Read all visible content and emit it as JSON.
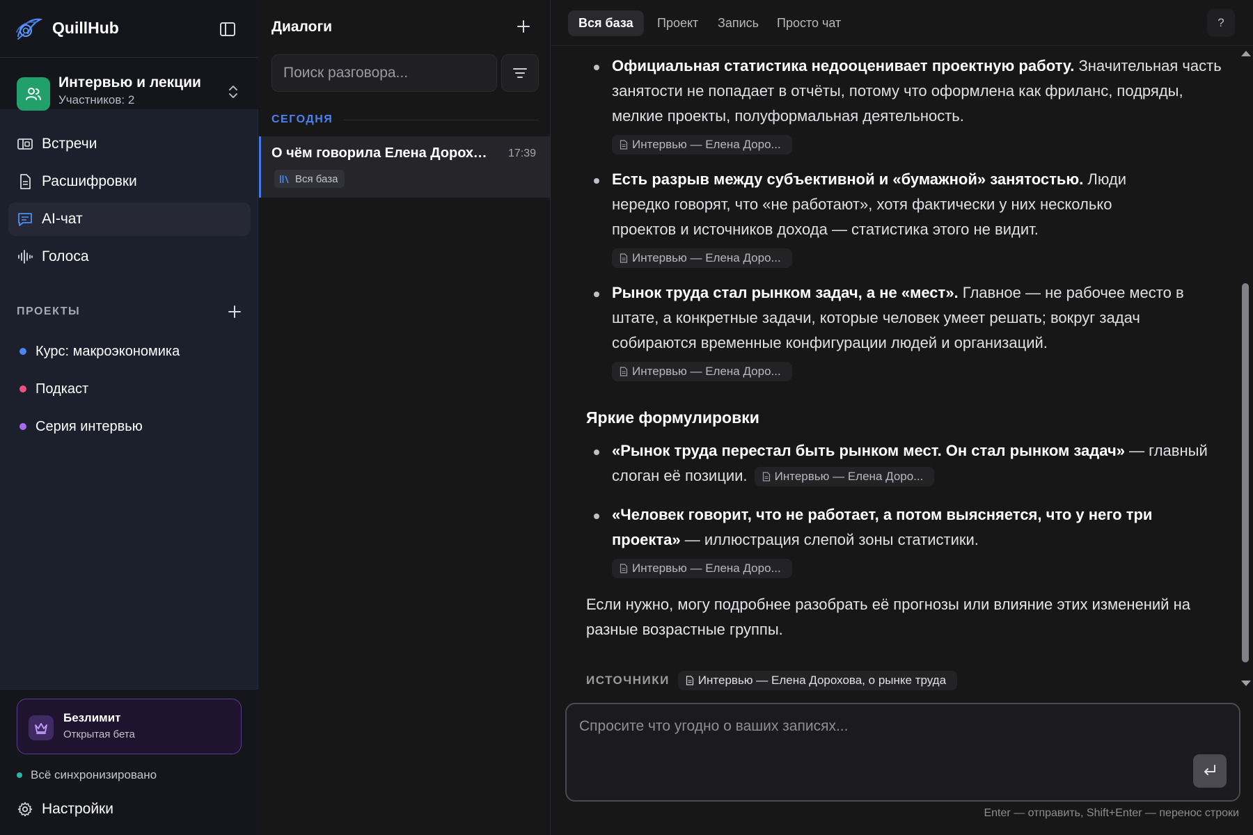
{
  "app": {
    "name": "QuillHub"
  },
  "workspace": {
    "name": "Интервью и лекции",
    "members": "Участников: 2"
  },
  "nav": [
    {
      "label": "Встречи",
      "icon": "meetings-icon"
    },
    {
      "label": "Расшифровки",
      "icon": "document-icon"
    },
    {
      "label": "AI-чат",
      "icon": "chat-icon",
      "active": true
    },
    {
      "label": "Голоса",
      "icon": "waveform-icon"
    }
  ],
  "projects": {
    "heading": "ПРОЕКТЫ",
    "items": [
      {
        "label": "Курс: макроэкономика",
        "color": "#4a86f0"
      },
      {
        "label": "Подкаст",
        "color": "#f0507e"
      },
      {
        "label": "Серия интервью",
        "color": "#a66cf0"
      }
    ]
  },
  "plan": {
    "title": "Безлимит",
    "subtitle": "Открытая бета"
  },
  "sync": {
    "label": "Всё синхронизировано",
    "color": "#2bb3a3"
  },
  "settings": {
    "label": "Настройки"
  },
  "dialogs": {
    "title": "Диалоги",
    "search_placeholder": "Поиск разговора...",
    "section": "СЕГОДНЯ",
    "items": [
      {
        "title": "О чём говорила Елена Дорохова",
        "time": "17:39",
        "tag": "Вся база"
      }
    ]
  },
  "tabs": [
    {
      "label": "Вся база",
      "active": true
    },
    {
      "label": "Проект"
    },
    {
      "label": "Запись"
    },
    {
      "label": "Просто чат"
    }
  ],
  "help": "?",
  "message": {
    "bullets": [
      {
        "bold": "Официальная статистика недооценивает проектную работу.",
        "text": " Значительная часть занятости не попадает в отчёты, потому что оформлена как фриланс, подряды, мелкие проекты, полуформальная деятельность.",
        "source": "Интервью — Елена Доро..."
      },
      {
        "bold": "Есть разрыв между субъективной и «бумажной» занятостью.",
        "text": " Люди нередко говорят, что «не работают», хотя фактически у них несколько проектов и источников дохода — статистика этого не видит.",
        "source": "Интервью — Елена Доро..."
      },
      {
        "bold": "Рынок труда стал рынком задач, а не «мест».",
        "text": " Главное — не рабочее место в штате, а конкретные задачи, которые человек умеет решать; вокруг задач собираются временные конфигурации людей и организаций.",
        "source": "Интервью — Елена Доро..."
      }
    ],
    "quotes_heading": "Яркие формулировки",
    "quotes": [
      {
        "bold": "«Рынок труда перестал быть рынком мест. Он стал рынком задач»",
        "text": " — главный слоган её позиции.",
        "source": "Интервью — Елена Доро..."
      },
      {
        "bold": "«Человек говорит, что не работает, а потом выясняется, что у него три проекта»",
        "text": " — иллюстрация слепой зоны статистики.",
        "source": "Интервью — Елена Доро..."
      }
    ],
    "closing": "Если нужно, могу подробнее разобрать её прогнозы или влияние этих изменений на разные возрастные группы.",
    "sources_label": "ИСТОЧНИКИ",
    "sources": [
      "Интервью — Елена Дорохова, о рынке труда"
    ]
  },
  "composer": {
    "placeholder": "Спросите что угодно о ваших записях...",
    "hint": "Enter — отправить, Shift+Enter — перенос строки"
  }
}
